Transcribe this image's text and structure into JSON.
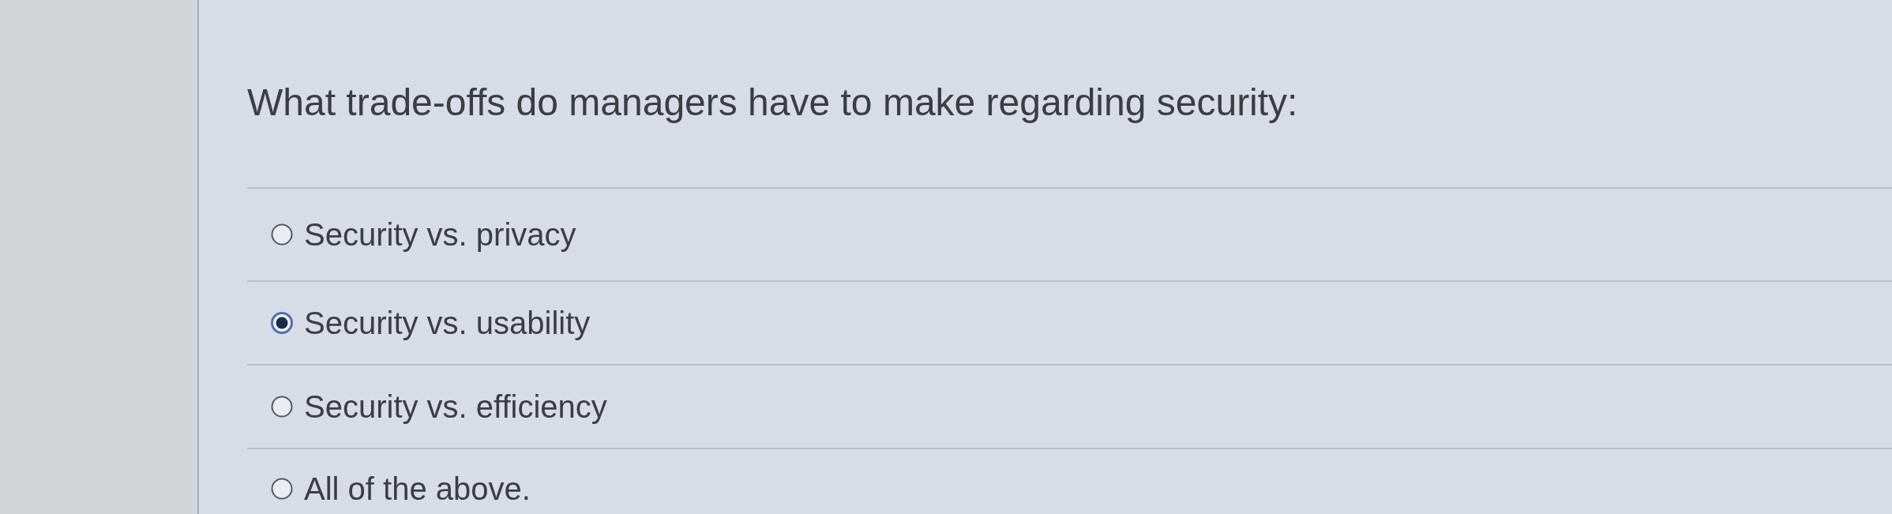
{
  "question": {
    "text": "What trade-offs do managers have to make regarding security:"
  },
  "options": [
    {
      "label": "Security vs. privacy",
      "selected": false
    },
    {
      "label": "Security vs. usability",
      "selected": true
    },
    {
      "label": "Security vs. efficiency",
      "selected": false
    },
    {
      "label": "All of the above.",
      "selected": false
    }
  ]
}
